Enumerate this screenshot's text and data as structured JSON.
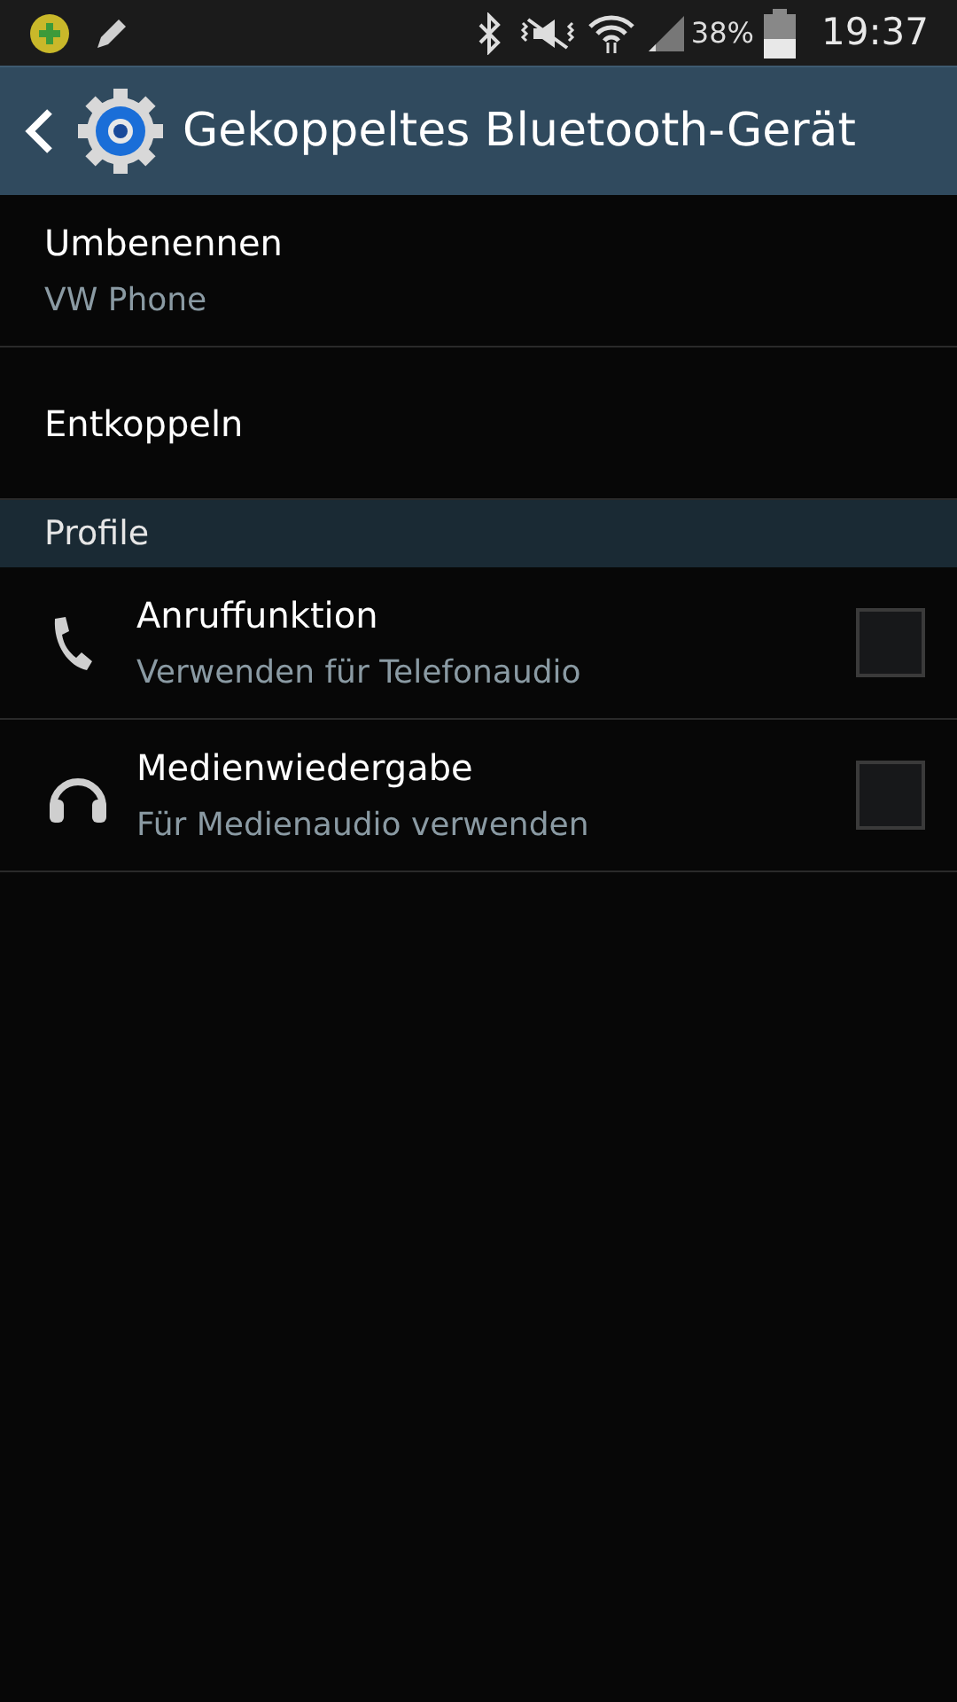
{
  "status_bar": {
    "battery": "38%",
    "time": "19:37"
  },
  "header": {
    "title": "Gekoppeltes Bluetooth-Gerät"
  },
  "items": [
    {
      "title": "Umbenennen",
      "subtitle": "VW Phone"
    },
    {
      "title": "Entkoppeln"
    }
  ],
  "section": {
    "title": "Profile"
  },
  "profiles": [
    {
      "kind": "call",
      "title": "Anruffunktion",
      "subtitle": "Verwenden für Telefonaudio",
      "checked": false
    },
    {
      "kind": "media",
      "title": "Medienwiedergabe",
      "subtitle": "Für Medienaudio verwenden",
      "checked": false
    }
  ]
}
